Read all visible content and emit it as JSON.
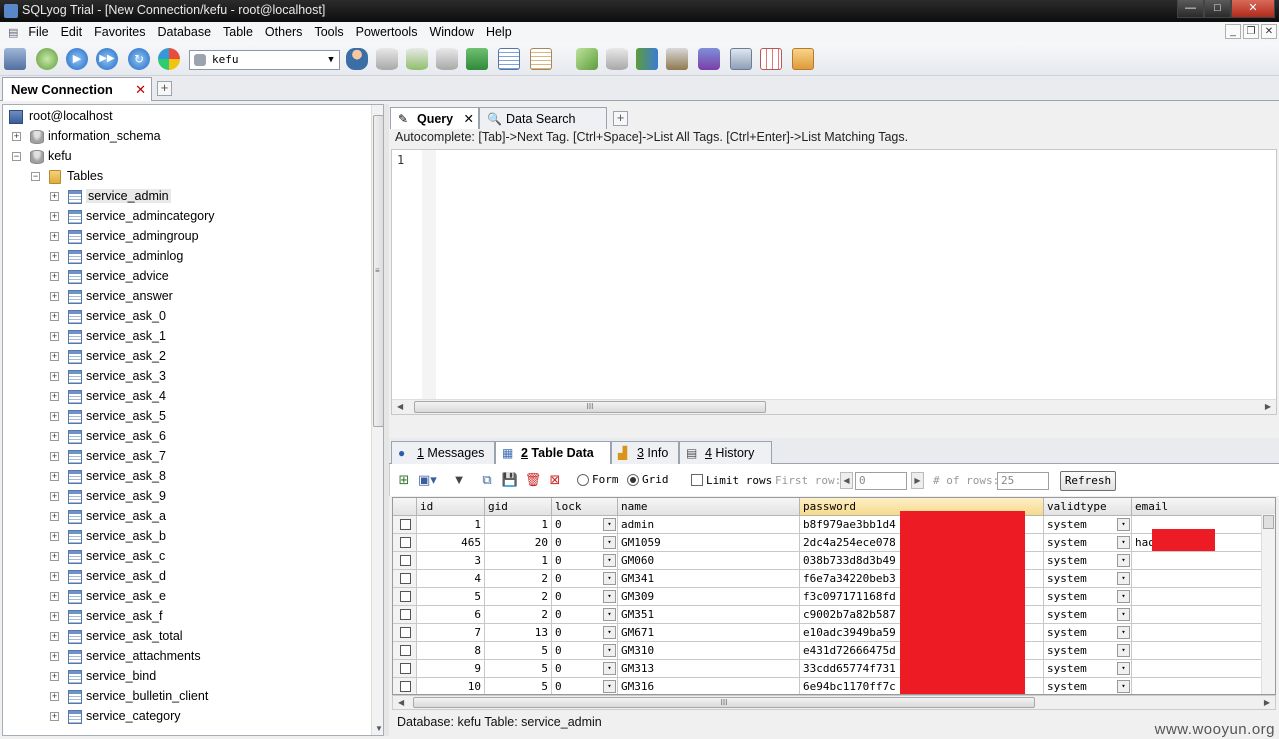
{
  "window": {
    "title": "SQLyog Trial - [New Connection/kefu - root@localhost]",
    "controls": {
      "minimize": "—",
      "maximize": "□",
      "close": "✕"
    },
    "mdi_controls": {
      "minimize": "_",
      "restore": "❐",
      "close": "✕"
    }
  },
  "menu": [
    "File",
    "Edit",
    "Favorites",
    "Database",
    "Table",
    "Others",
    "Tools",
    "Powertools",
    "Window",
    "Help"
  ],
  "toolbar": {
    "database_select": "kefu",
    "dropdown_arrow": "▼"
  },
  "connection_tab": {
    "label": "New Connection",
    "close": "✕",
    "add": "+"
  },
  "tree": {
    "root": "root@localhost",
    "databases": [
      {
        "name": "information_schema",
        "expanded": false
      },
      {
        "name": "kefu",
        "expanded": true
      }
    ],
    "folder": "Tables",
    "tables": [
      "service_admin",
      "service_admincategory",
      "service_admingroup",
      "service_adminlog",
      "service_advice",
      "service_answer",
      "service_ask_0",
      "service_ask_1",
      "service_ask_2",
      "service_ask_3",
      "service_ask_4",
      "service_ask_5",
      "service_ask_6",
      "service_ask_7",
      "service_ask_8",
      "service_ask_9",
      "service_ask_a",
      "service_ask_b",
      "service_ask_c",
      "service_ask_d",
      "service_ask_e",
      "service_ask_f",
      "service_ask_total",
      "service_attachments",
      "service_bind",
      "service_bulletin_client",
      "service_category"
    ],
    "expand_plus": "+",
    "expand_minus": "−"
  },
  "query_tabs": [
    {
      "label": "Query",
      "close": "✕"
    },
    {
      "label": "Data Search"
    }
  ],
  "query_tab_add": "+",
  "autocomplete_hint": "Autocomplete: [Tab]->Next Tag. [Ctrl+Space]->List All Tags. [Ctrl+Enter]->List Matching Tags.",
  "editor": {
    "line_number": "1",
    "content": ""
  },
  "result_tabs": [
    {
      "num": "1",
      "label": " Messages",
      "active": false
    },
    {
      "num": "2",
      "label": " Table Data",
      "active": true
    },
    {
      "num": "3",
      "label": " Info",
      "active": false
    },
    {
      "num": "4",
      "label": " History",
      "active": false
    }
  ],
  "data_toolbar": {
    "form_label": "Form",
    "grid_label": "Grid",
    "view_mode": "Grid",
    "limit_rows_label": "Limit rows",
    "limit_rows_checked": false,
    "first_row_label": "First row:",
    "first_row_value": "0",
    "num_rows_label": "# of rows:",
    "num_rows_value": "25",
    "refresh_label": "Refresh"
  },
  "grid": {
    "columns": [
      "id",
      "gid",
      "lock",
      "name",
      "password",
      "validtype",
      "email"
    ],
    "selected_column": "password",
    "rows": [
      {
        "id": "1",
        "gid": "1",
        "lock": "0",
        "name": "admin",
        "password": "b8f979ae3bb1d4",
        "validtype": "system",
        "email": ""
      },
      {
        "id": "465",
        "gid": "20",
        "lock": "0",
        "name": "GM1059",
        "password": "2dc4a254ece078",
        "validtype": "system",
        "email": "hao          @kings"
      },
      {
        "id": "3",
        "gid": "1",
        "lock": "0",
        "name": "GM060",
        "password": "038b733d8d3b49",
        "validtype": "system",
        "email": ""
      },
      {
        "id": "4",
        "gid": "2",
        "lock": "0",
        "name": "GM341",
        "password": "f6e7a34220beb3",
        "validtype": "system",
        "email": ""
      },
      {
        "id": "5",
        "gid": "2",
        "lock": "0",
        "name": "GM309",
        "password": "f3c097171168fd",
        "validtype": "system",
        "email": ""
      },
      {
        "id": "6",
        "gid": "2",
        "lock": "0",
        "name": "GM351",
        "password": "c9002b7a82b587",
        "validtype": "system",
        "email": ""
      },
      {
        "id": "7",
        "gid": "13",
        "lock": "0",
        "name": "GM671",
        "password": "e10adc3949ba59",
        "validtype": "system",
        "email": ""
      },
      {
        "id": "8",
        "gid": "5",
        "lock": "0",
        "name": "GM310",
        "password": "e431d72666475d",
        "validtype": "system",
        "email": ""
      },
      {
        "id": "9",
        "gid": "5",
        "lock": "0",
        "name": "GM313",
        "password": "33cdd65774f731",
        "validtype": "system",
        "email": ""
      },
      {
        "id": "10",
        "gid": "5",
        "lock": "0",
        "name": "GM316",
        "password": "6e94bc1170ff7c",
        "validtype": "system",
        "email": ""
      }
    ],
    "cell_dropdown": "▾"
  },
  "scroll_grip": "III",
  "status": "Database: kefu  Table: service_admin",
  "watermark": "www.wooyun.org",
  "colors": {
    "redaction": "#ed1c24",
    "selected_header": "#f6d98a"
  },
  "icons": {
    "toolbar": [
      "new-connection-icon",
      "connect-icon",
      "execute-icon",
      "execute-all-icon",
      "refresh-icon",
      "schema-icon",
      "user-manager-icon",
      "create-db-icon",
      "create-table-icon",
      "backup-icon",
      "restore-icon",
      "table-designer-icon",
      "index-icon",
      "sync-icon",
      "import-icon",
      "export-icon",
      "copy-db-icon",
      "scheduler-icon",
      "query-builder-icon",
      "schema-designer-icon",
      "visual-icon"
    ]
  }
}
